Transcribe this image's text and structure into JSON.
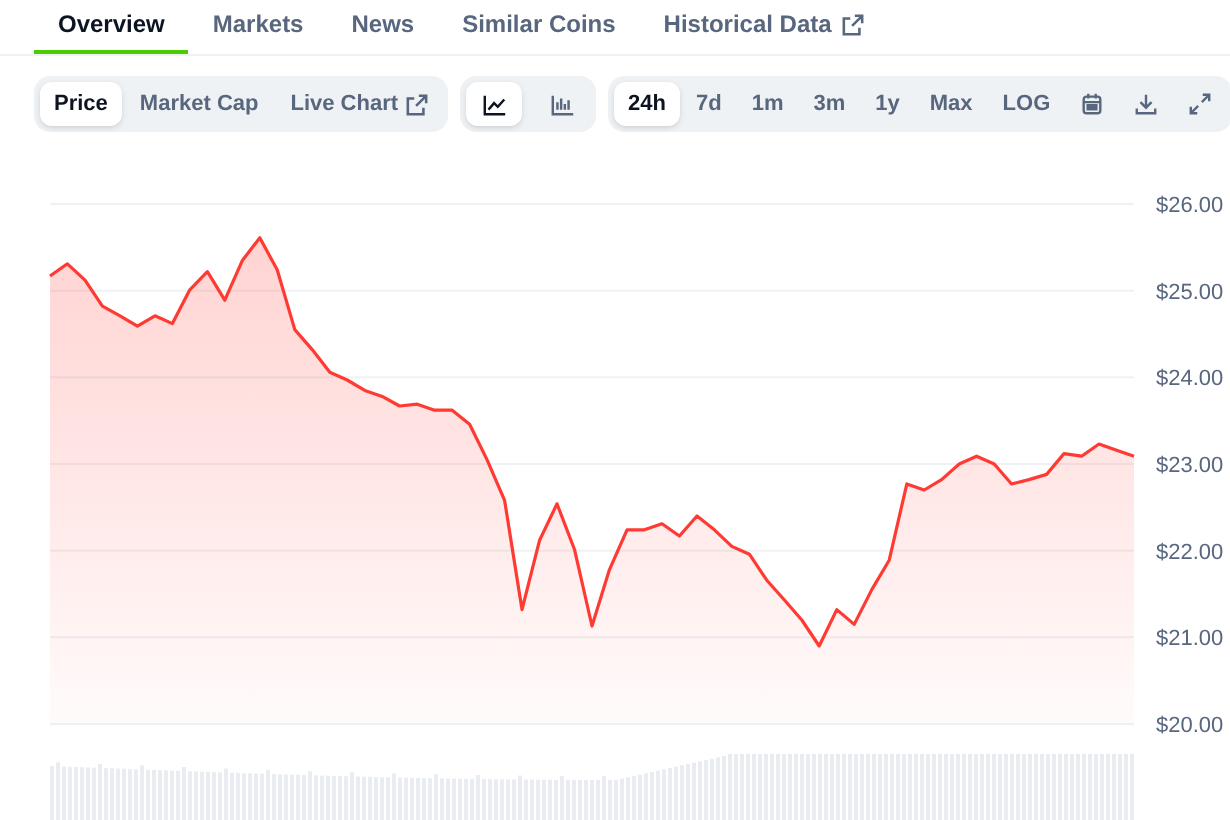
{
  "tabs": [
    {
      "label": "Overview",
      "selected": true,
      "external": false
    },
    {
      "label": "Markets",
      "selected": false,
      "external": false
    },
    {
      "label": "News",
      "selected": false,
      "external": false
    },
    {
      "label": "Similar Coins",
      "selected": false,
      "external": false
    },
    {
      "label": "Historical Data",
      "selected": false,
      "external": true
    }
  ],
  "metric_toggles": [
    {
      "label": "Price",
      "selected": true,
      "external": false
    },
    {
      "label": "Market Cap",
      "selected": false,
      "external": false
    },
    {
      "label": "Live Chart",
      "selected": false,
      "external": true
    }
  ],
  "chart_style_toggles": [
    {
      "kind": "line",
      "selected": true
    },
    {
      "kind": "bars",
      "selected": false
    }
  ],
  "range_toggles": [
    {
      "label": "24h",
      "selected": true
    },
    {
      "label": "7d",
      "selected": false
    },
    {
      "label": "1m",
      "selected": false
    },
    {
      "label": "3m",
      "selected": false
    },
    {
      "label": "1y",
      "selected": false
    },
    {
      "label": "Max",
      "selected": false
    },
    {
      "label": "LOG",
      "selected": false
    }
  ],
  "tools": [
    {
      "kind": "calendar"
    },
    {
      "kind": "download"
    },
    {
      "kind": "expand"
    }
  ],
  "chart_data": {
    "type": "area",
    "grid": true,
    "ylim": [
      20,
      26
    ],
    "yticks": [
      {
        "value": 20,
        "label": "$20.00"
      },
      {
        "value": 21,
        "label": "$21.00"
      },
      {
        "value": 22,
        "label": "$22.00"
      },
      {
        "value": 23,
        "label": "$23.00"
      },
      {
        "value": 24,
        "label": "$24.00"
      },
      {
        "value": 25,
        "label": "$25.00"
      },
      {
        "value": 26,
        "label": "$26.00"
      }
    ],
    "series": [
      {
        "color": "#ff3a33",
        "values": [
          25.17,
          25.31,
          25.12,
          24.82,
          24.71,
          24.59,
          24.71,
          24.62,
          25.01,
          25.22,
          24.89,
          25.35,
          25.61,
          25.24,
          24.55,
          24.32,
          24.06,
          23.97,
          23.85,
          23.78,
          23.67,
          23.69,
          23.62,
          23.62,
          23.46,
          23.05,
          22.58,
          21.32,
          22.12,
          22.54,
          22.01,
          21.13,
          21.78,
          22.24,
          22.24,
          22.31,
          22.17,
          22.4,
          22.24,
          22.05,
          21.96,
          21.66,
          21.43,
          21.2,
          20.9,
          21.32,
          21.15,
          21.55,
          21.89,
          22.77,
          22.7,
          22.82,
          23.0,
          23.09,
          23.0,
          22.77,
          22.82,
          22.88,
          23.12,
          23.09,
          23.23,
          23.16,
          23.09
        ]
      }
    ]
  }
}
